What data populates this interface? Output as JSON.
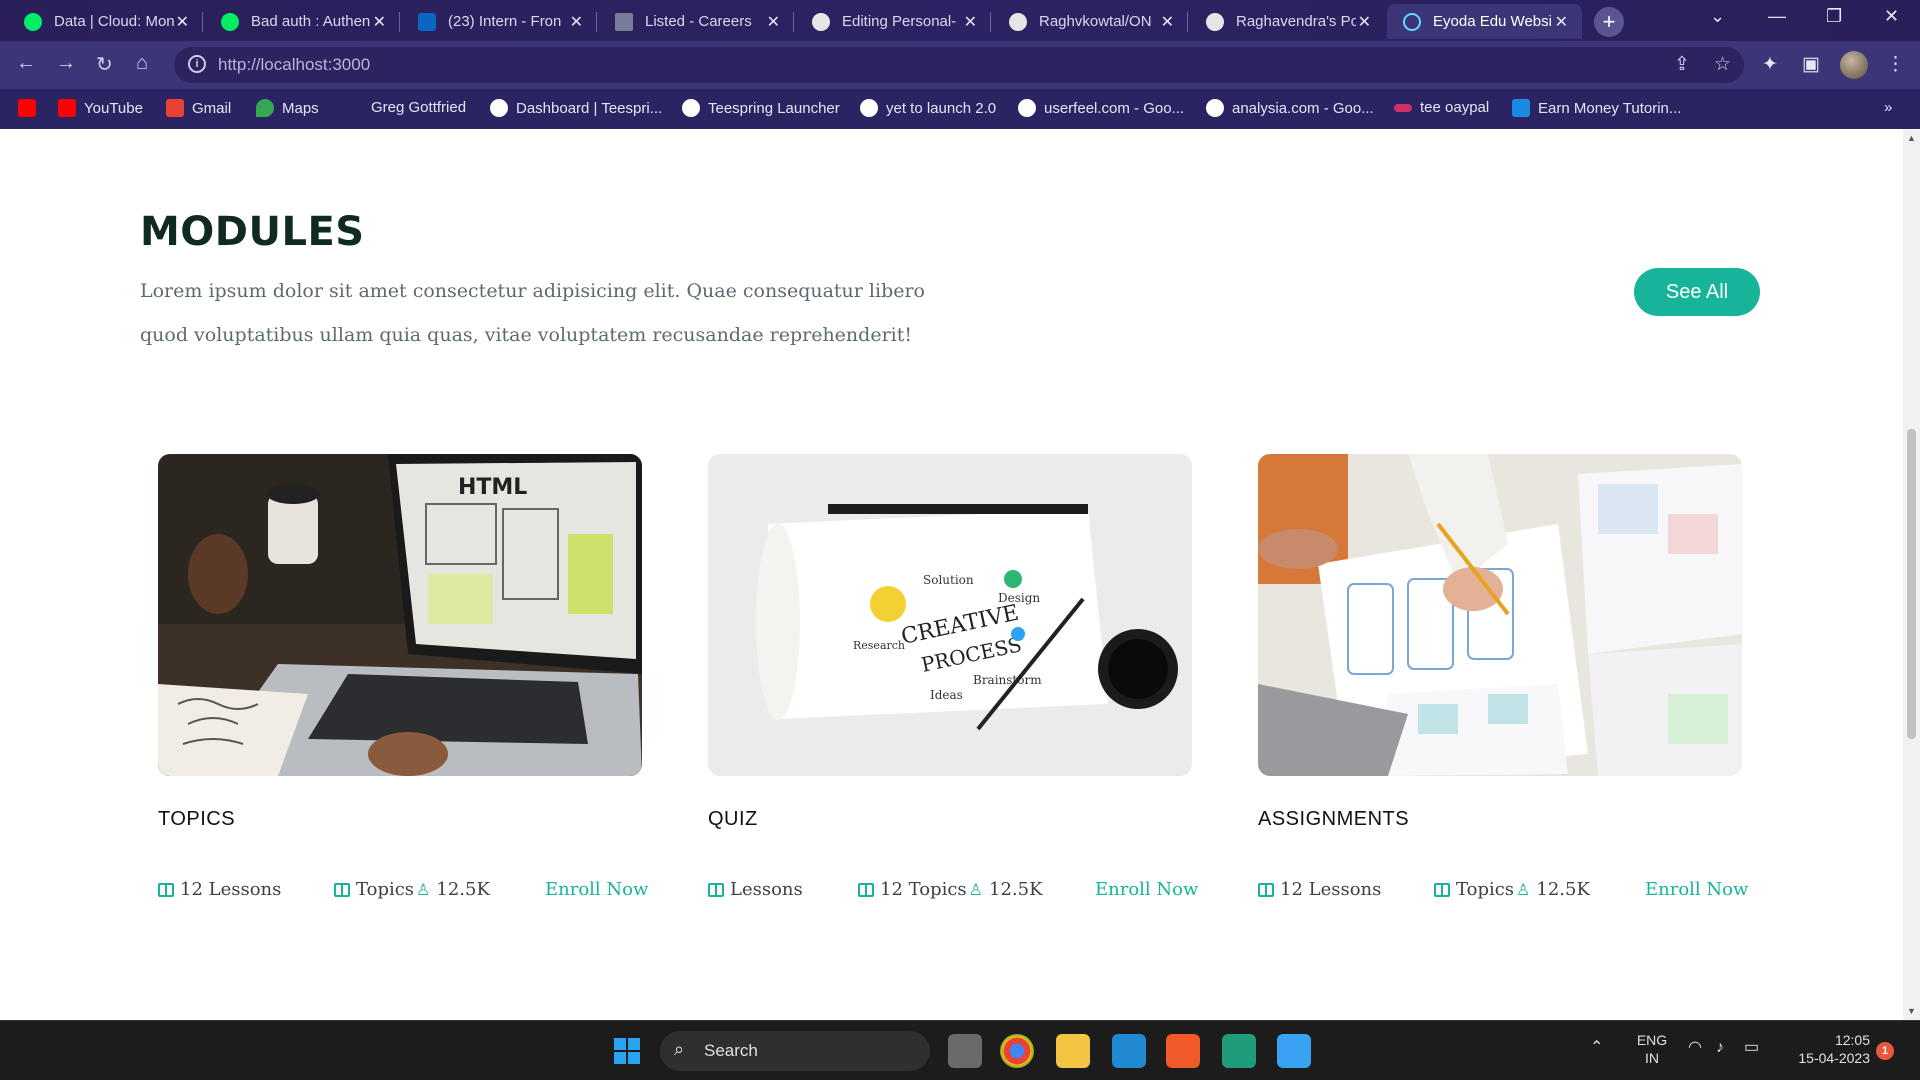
{
  "browser": {
    "tabs": [
      {
        "title": "Data | Cloud: Mon",
        "fav_color": "#00ed64"
      },
      {
        "title": "Bad auth : Authen",
        "fav_color": "#00ed64"
      },
      {
        "title": "(23) Intern - Fron",
        "fav_color": "#0a66c2"
      },
      {
        "title": "Listed - Careers",
        "fav_color": "#7a7a9a"
      },
      {
        "title": "Editing Personal-",
        "fav_color": "#e6e6e6"
      },
      {
        "title": "Raghvkowtal/ON",
        "fav_color": "#e6e6e6"
      },
      {
        "title": "Raghavendra's Po",
        "fav_color": "#e6e6e6"
      },
      {
        "title": "Eyoda Edu Websi",
        "fav_color": "#61dafb",
        "active": true
      }
    ],
    "new_tab": "+",
    "url": "http://localhost:3000",
    "bookmarks": [
      {
        "label": "",
        "color": "#ff0000"
      },
      {
        "label": "YouTube",
        "color": "#ff0000"
      },
      {
        "label": "Gmail",
        "color": "#ea4335"
      },
      {
        "label": "Maps",
        "color": "#34a853"
      },
      {
        "label": "Greg Gottfried",
        "color": ""
      },
      {
        "label": "Dashboard | Teespri...",
        "color": "#ffffff"
      },
      {
        "label": "Teespring Launcher",
        "color": "#ffffff"
      },
      {
        "label": "yet to launch 2.0",
        "color": "#ffffff"
      },
      {
        "label": "userfeel.com - Goo...",
        "color": "#ffffff"
      },
      {
        "label": "analysia.com - Goo...",
        "color": "#ffffff"
      },
      {
        "label": "tee oaypal",
        "color": "#d0306a"
      },
      {
        "label": "Earn Money Tutorin...",
        "color": "#1e88e5"
      }
    ],
    "more_bookmarks": "»"
  },
  "page": {
    "title": "MODULES",
    "description": "Lorem ipsum dolor sit amet consectetur adipisicing elit. Quae consequatur libero quod voluptatibus ullam quia quas, vitae voluptatem recusandae reprehenderit!",
    "see_all": "See All",
    "cards": [
      {
        "title": "TOPICS",
        "lessons": "12 Lessons",
        "topics": "Topics",
        "learners": "12.5K",
        "enroll": "Enroll Now",
        "image": "laptop-html-wireframe"
      },
      {
        "title": "QUIZ",
        "lessons": "Lessons",
        "topics": "12 Topics",
        "learners": "12.5K",
        "enroll": "Enroll Now",
        "image": "creative-process-sketch"
      },
      {
        "title": "ASSIGNMENTS",
        "lessons": "12 Lessons",
        "topics": "Topics",
        "learners": "12.5K",
        "enroll": "Enroll Now",
        "image": "ux-wireframe-drawing"
      }
    ]
  },
  "taskbar": {
    "search": "Search",
    "lang": "ENG",
    "region": "IN",
    "time": "12:05",
    "date": "15-04-2023",
    "notifications": "1"
  }
}
